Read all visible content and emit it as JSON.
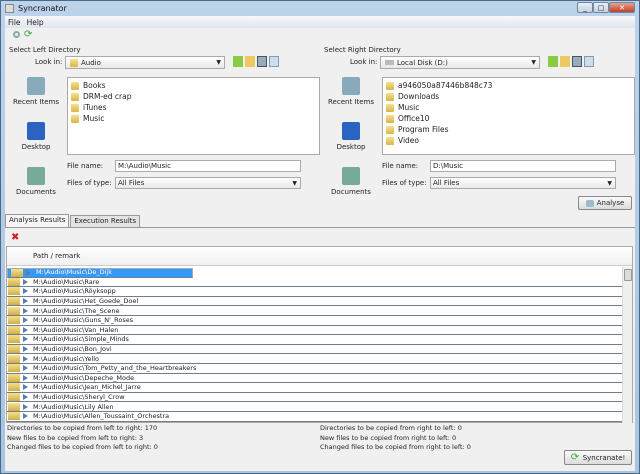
{
  "window": {
    "title": "Syncranator"
  },
  "menu": [
    "File",
    "Help"
  ],
  "toolbar": {
    "icons": [
      "magnifier-icon",
      "refresh-icon"
    ]
  },
  "left": {
    "label": "Select Left Directory",
    "look_in_label": "Look in:",
    "look_in": "Audio",
    "shortcuts": [
      "Recent Items",
      "Desktop",
      "Documents"
    ],
    "files": [
      "Books",
      "DRM-ed crap",
      "iTunes",
      "Music"
    ],
    "file_name_label": "File name:",
    "file_name": "M:\\Audio\\Music",
    "file_type_label": "Files of type:",
    "file_type": "All Files"
  },
  "right": {
    "label": "Select Right Directory",
    "look_in_label": "Look in:",
    "look_in": "Local Disk (D:)",
    "shortcuts": [
      "Recent Items",
      "Desktop",
      "Documents"
    ],
    "files": [
      "a946050a87446b848c73",
      "Downloads",
      "Music",
      "Office10",
      "Program Files",
      "Video"
    ],
    "file_name_label": "File name:",
    "file_name": "D:\\Music",
    "file_type_label": "Files of type:",
    "file_type": "All Files"
  },
  "analyse_label": "Analyse",
  "tabs": [
    "Analysis Results",
    "Execution Results"
  ],
  "table": {
    "header": "Path / remark",
    "rows": [
      "M:\\Audio\\Music\\De_Dijk",
      "M:\\Audio\\Music\\Rare",
      "M:\\Audio\\Music\\Röyksopp",
      "M:\\Audio\\Music\\Het_Goede_Doel",
      "M:\\Audio\\Music\\The_Scene",
      "M:\\Audio\\Music\\Guns_N'_Roses",
      "M:\\Audio\\Music\\Van_Halen",
      "M:\\Audio\\Music\\Simple_Minds",
      "M:\\Audio\\Music\\Bon_Jovi",
      "M:\\Audio\\Music\\Yello",
      "M:\\Audio\\Music\\Tom_Petty_and_the_Heartbreakers",
      "M:\\Audio\\Music\\Depeche_Mode",
      "M:\\Audio\\Music\\Jean_Michel_Jarre",
      "M:\\Audio\\Music\\Sheryl_Crow",
      "M:\\Audio\\Music\\Lily Allen",
      "M:\\Audio\\Music\\Allen_Toussaint_Orchestra"
    ],
    "selected_index": 0
  },
  "status": {
    "left": [
      "Directories to be copied from left to right: 170",
      "New files to be copied from left to right: 3",
      "Changed files to be copied from left to right: 0"
    ],
    "right": [
      "Directories to be copied from right to left: 0",
      "New files to be copied from right to left: 0",
      "Changed files to be copied from right to left: 0"
    ]
  },
  "syncranate_label": "Syncranate!"
}
